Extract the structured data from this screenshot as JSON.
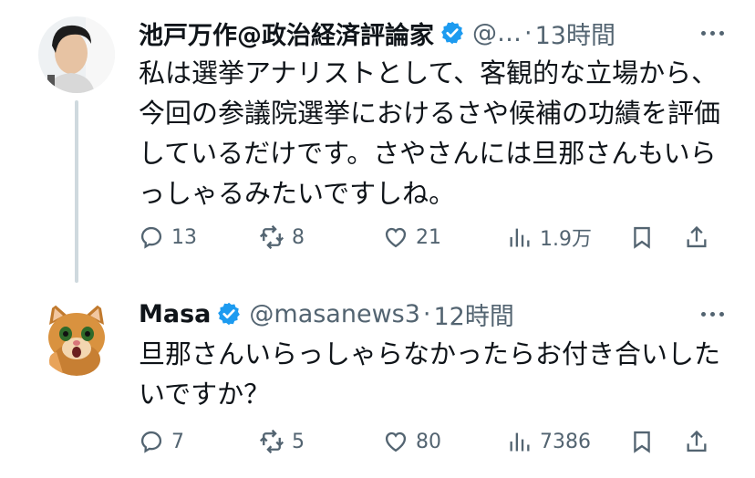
{
  "tweets": [
    {
      "name": "池戸万作@政治経済評論家",
      "handle": "@…",
      "sep": "·",
      "time": "13時間",
      "text": "私は選挙アナリストとして、客観的な立場から、今回の参議院選挙におけるさや候補の功績を評価しているだけです。さやさんには旦那さんもいらっしゃるみたいですしね。",
      "replies": "13",
      "reposts": "8",
      "likes": "21",
      "views": "1.9万"
    },
    {
      "name": "Masa",
      "handle": "@masanews3",
      "sep": "·",
      "time": "12時間",
      "text": "旦那さんいらっしゃらなかったらお付き合いしたいですか？",
      "replies": "7",
      "reposts": "5",
      "likes": "80",
      "views": "7386"
    }
  ],
  "colors": {
    "verified": "#1d9bf0",
    "muted": "#536471",
    "text": "#0f1419",
    "thread": "#cfd9de"
  },
  "icons": [
    "reply-icon",
    "repost-icon",
    "like-icon",
    "views-icon",
    "bookmark-icon",
    "share-icon",
    "verified-badge-icon",
    "more-icon"
  ]
}
